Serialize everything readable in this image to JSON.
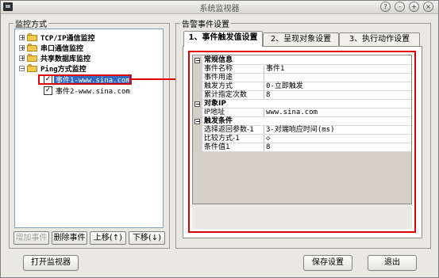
{
  "window": {
    "title": "系统监视器",
    "controls": [
      "help",
      "minimize",
      "maximize",
      "close"
    ]
  },
  "left_panel": {
    "label": "监控方式",
    "tree": [
      {
        "label": "TCP/IP通信监控",
        "expanded": false
      },
      {
        "label": "串口通信监控",
        "expanded": false
      },
      {
        "label": "共享数据库监控",
        "expanded": false
      },
      {
        "label": "Ping方式监控",
        "expanded": true,
        "children": [
          {
            "label": "事件1-www.sina.com",
            "checked": true,
            "selected": true
          },
          {
            "label": "事件2-www.sina.com",
            "checked": true,
            "selected": false
          }
        ]
      }
    ],
    "buttons": {
      "add": "增加事件",
      "delete": "删除事件",
      "move_up": "上移(↑)",
      "move_down": "下移(↓)"
    }
  },
  "right_panel": {
    "label": "告警事件设置",
    "tabs": [
      "1、事件触发值设置",
      "2、呈现对象设置",
      "3、执行动作设置"
    ],
    "active_tab": 0,
    "properties": {
      "cat1": "常规信息",
      "rows1": [
        {
          "k": "事件名称",
          "v": "事件1"
        },
        {
          "k": "事件用途",
          "v": ""
        },
        {
          "k": "触发方式",
          "v": "0-立即触发"
        },
        {
          "k": "累计指定次数",
          "v": "8"
        }
      ],
      "cat2": "对象IP",
      "rows2": [
        {
          "k": "IP地址",
          "v": "www.sina.com"
        }
      ],
      "cat3": "触发条件",
      "rows3": [
        {
          "k": "选择返回参数-1",
          "v": "3-对端响应时间(ms)"
        },
        {
          "k": "比较方式-1",
          "v": "◇"
        },
        {
          "k": "条件值1",
          "v": "8"
        }
      ]
    }
  },
  "bottom": {
    "open_monitor": "打开监视器",
    "save": "保存设置",
    "exit": "退出"
  },
  "colors": {
    "highlight": "#e00000",
    "tree_selection": "#316ac5"
  }
}
